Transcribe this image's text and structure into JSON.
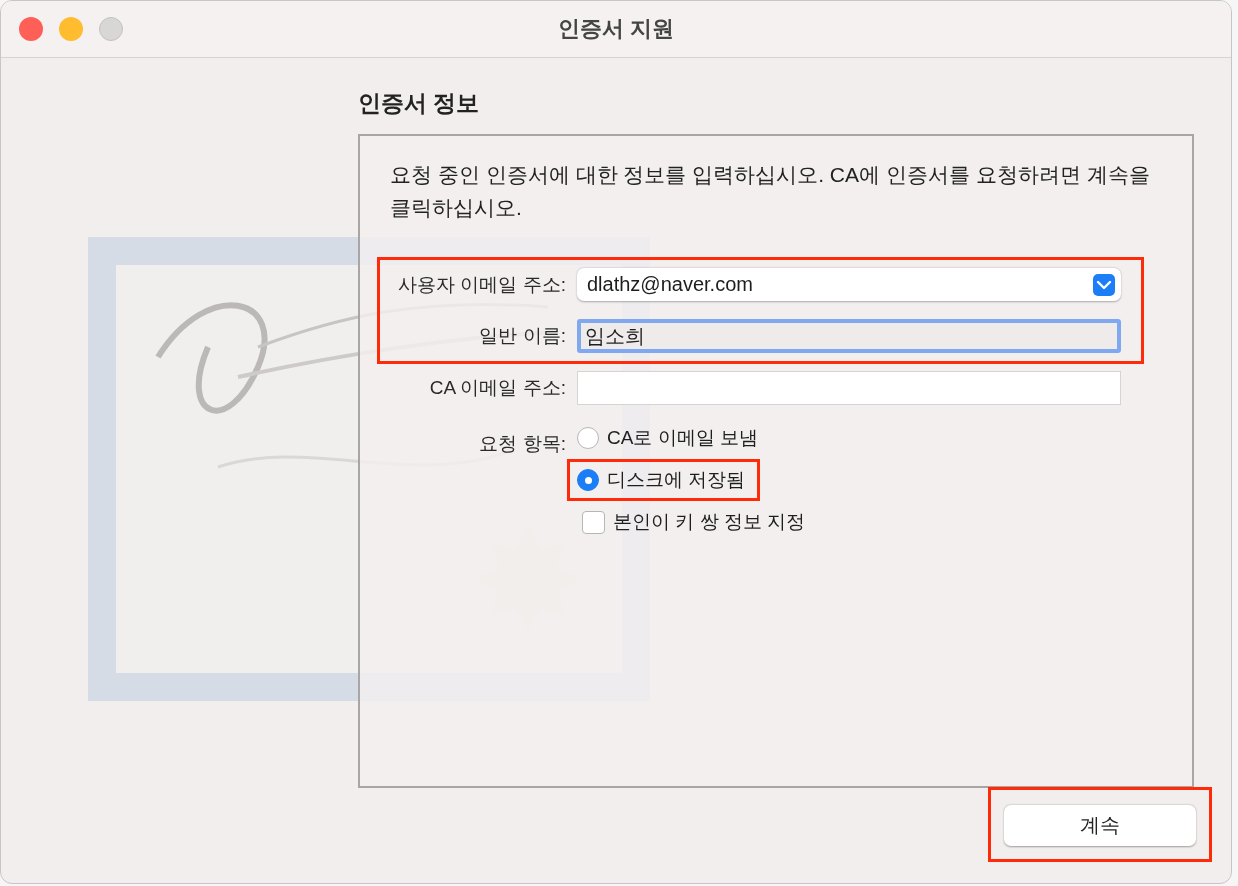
{
  "window": {
    "title": "인증서 지원"
  },
  "heading": "인증서 정보",
  "description": "요청 중인 인증서에 대한 정보를 입력하십시오. CA에 인증서를 요청하려면 계속을 클릭하십시오.",
  "fields": [
    {
      "kind": "popup",
      "label": "사용자 이메일 주소:",
      "value": "dlathz@naver.com",
      "highlighted": true
    },
    {
      "kind": "text",
      "label": "일반 이름:",
      "value": "임소희",
      "focused": true,
      "highlighted": true
    },
    {
      "kind": "text",
      "label": "CA 이메일 주소:",
      "focused": false,
      "highlighted": false
    }
  ],
  "request": {
    "label": "요청 항목:",
    "options": [
      {
        "label": "CA로 이메일 보냄",
        "selected": false,
        "highlighted": false
      },
      {
        "label": "디스크에 저장됨",
        "selected": true,
        "highlighted": true
      }
    ]
  },
  "key_pair": {
    "label": "본인이 키 쌍 정보 지정",
    "checked": false
  },
  "continue_button": {
    "label": "계속",
    "highlighted": true
  }
}
